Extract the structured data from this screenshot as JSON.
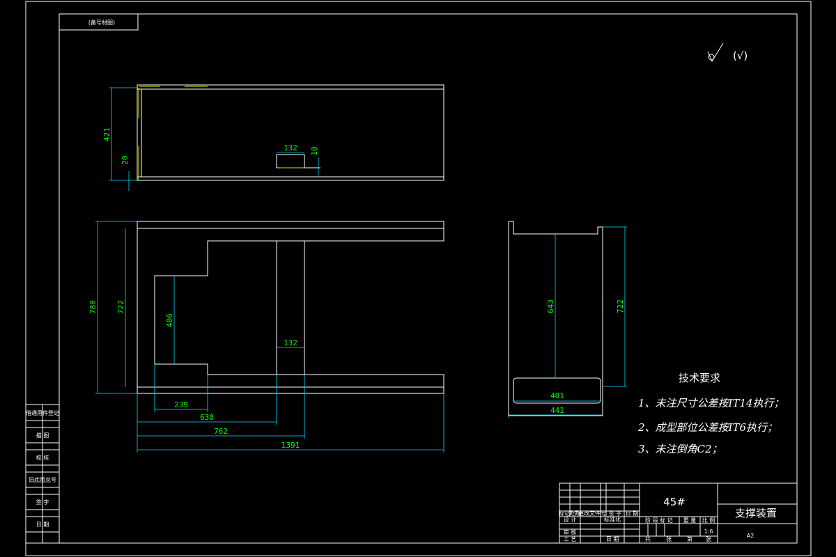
{
  "top_label": "(备号材图)",
  "roughness": "√",
  "roughness_paren": "(√)",
  "dims_top": {
    "height": "421",
    "offset": "20",
    "slot_w": "132",
    "slot_h": "10"
  },
  "dims_front": {
    "h_outer": "780",
    "h_inner": "722",
    "h_pocket": "406",
    "slot_w": "132",
    "d1": "239",
    "d2": "630",
    "d3": "762",
    "d4": "1391"
  },
  "dims_side": {
    "h_inner": "643",
    "h_outer": "722",
    "w_inner": "401",
    "w_outer": "441"
  },
  "notes": {
    "title": "技术要求",
    "items": [
      "1、未注尺寸公差按IT14执行；",
      "2、成型部位公差按IT6执行；",
      "3、未注倒角C2；"
    ]
  },
  "left_column": [
    "借通用件登记",
    "描 图",
    "校 核",
    "旧底图总号",
    "签 字",
    "日 期"
  ],
  "title_block": {
    "material": "45#",
    "part_name": "支撑装置",
    "sheet_size": "A2",
    "scale": "1:6",
    "header_row": [
      "标记",
      "处数",
      "更改文件号",
      "签 字",
      "日 期"
    ],
    "row_labels": [
      "设 计",
      "标准化",
      "审 核",
      "工 艺"
    ],
    "mid_row": [
      "阶 段 标 记",
      "重 量",
      "比 例"
    ],
    "sheet_row": [
      "共",
      "张",
      "第",
      "张"
    ],
    "date_label": "日 期"
  }
}
